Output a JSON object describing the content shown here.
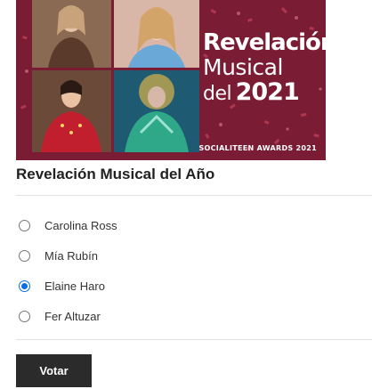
{
  "banner": {
    "line1": "Revelación",
    "line2": "Musical",
    "line3a": "del",
    "line3b": "2021",
    "awards": "SOCIALITEEN AWARDS 2021"
  },
  "poll": {
    "title": "Revelación Musical del Año",
    "options": [
      {
        "label": "Carolina Ross",
        "selected": false
      },
      {
        "label": "Mía Rubín",
        "selected": false
      },
      {
        "label": "Elaine Haro",
        "selected": true
      },
      {
        "label": "Fer Altuzar",
        "selected": false
      }
    ],
    "vote_label": "Votar"
  },
  "colors": {
    "banner_bg": "#7a1c33",
    "radio_selected": "#0a6fe0",
    "button_bg": "#2b2b2b"
  }
}
